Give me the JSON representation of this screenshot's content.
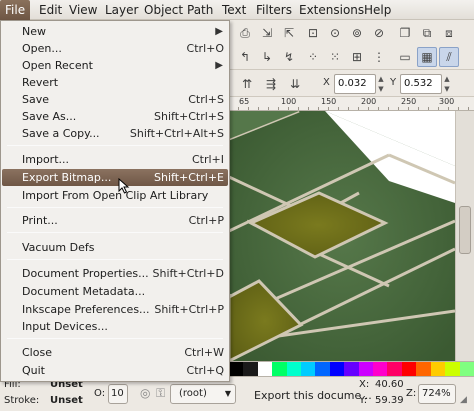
{
  "menubar": {
    "items": [
      "File",
      "Edit",
      "View",
      "Layer",
      "Object",
      "Path",
      "Text",
      "Filters",
      "Extensions",
      "Help"
    ]
  },
  "file_menu": {
    "items": [
      {
        "label": "New",
        "shortcut": "",
        "submenu": true
      },
      {
        "label": "Open...",
        "shortcut": "Ctrl+O"
      },
      {
        "label": "Open Recent",
        "shortcut": "",
        "submenu": true
      },
      {
        "label": "Revert",
        "shortcut": ""
      },
      {
        "label": "Save",
        "shortcut": "Ctrl+S"
      },
      {
        "label": "Save As...",
        "shortcut": "Shift+Ctrl+S"
      },
      {
        "label": "Save a Copy...",
        "shortcut": "Shift+Ctrl+Alt+S"
      },
      {
        "label": "Import...",
        "shortcut": "Ctrl+I"
      },
      {
        "label": "Export Bitmap...",
        "shortcut": "Shift+Ctrl+E",
        "highlighted": true
      },
      {
        "label": "Import From Open Clip Art Library",
        "shortcut": ""
      },
      {
        "label": "Print...",
        "shortcut": "Ctrl+P"
      },
      {
        "label": "Vacuum Defs",
        "shortcut": ""
      },
      {
        "label": "Document Properties...",
        "shortcut": "Shift+Ctrl+D"
      },
      {
        "label": "Document Metadata...",
        "shortcut": ""
      },
      {
        "label": "Inkscape Preferences...",
        "shortcut": "Shift+Ctrl+P"
      },
      {
        "label": "Input Devices...",
        "shortcut": ""
      },
      {
        "label": "Close",
        "shortcut": "Ctrl+W"
      },
      {
        "label": "Quit",
        "shortcut": "Ctrl+Q"
      }
    ]
  },
  "controls": {
    "x_label": "X",
    "x_value": "0.032",
    "y_label": "Y",
    "y_value": "0.532"
  },
  "ruler": {
    "ticks": [
      "65",
      "100",
      "150",
      "200",
      "250",
      "300"
    ]
  },
  "statusbar": {
    "fill_label": "Fill:",
    "fill_value": "Unset",
    "stroke_label": "Stroke:",
    "stroke_value": "Unset",
    "opacity_label": "O:",
    "opacity_value": "10",
    "layer_value": "(root)",
    "message": "Export this docume...",
    "x_label": "X:",
    "x_value": "40.60",
    "y_label": "Y:",
    "y_value": "59.39",
    "zoom_label": "Z:",
    "zoom_value": "724%"
  },
  "colors": {
    "menu_highlight": "#7b6352",
    "tile_green": "#486b3d",
    "tile_olive": "#6d6e1a",
    "grout": "#c9c2b0"
  },
  "palette": [
    "#000000",
    "#1a1a1a",
    "#ffffff",
    "#00ff66",
    "#00ffcc",
    "#00ccff",
    "#0066ff",
    "#0000ff",
    "#6600ff",
    "#cc00ff",
    "#ff00cc",
    "#ff0066",
    "#ff0000",
    "#ff6600",
    "#ffcc00",
    "#ccff00",
    "#80ff80"
  ]
}
